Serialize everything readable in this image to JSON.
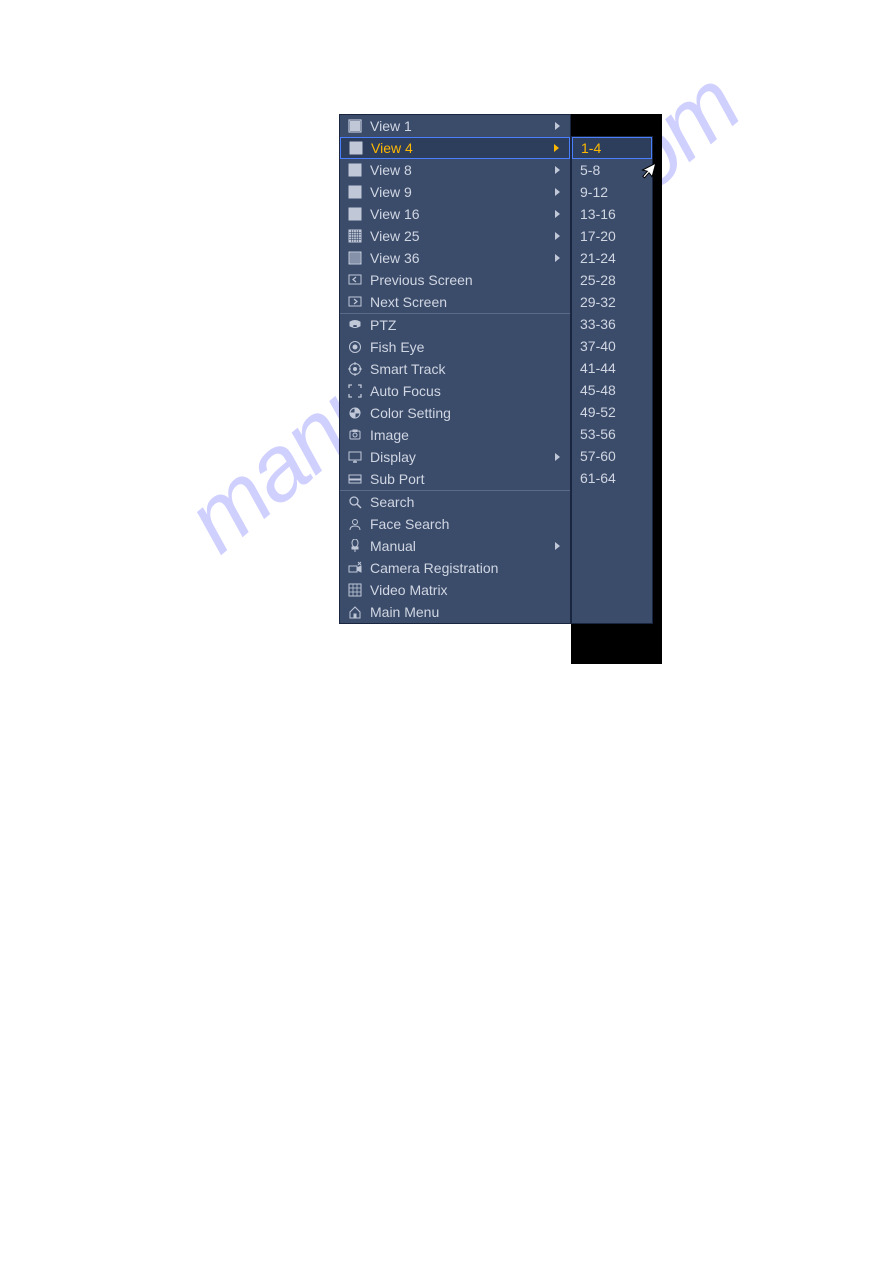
{
  "watermark": "manualshive.com",
  "menu": {
    "sections": [
      {
        "items": [
          {
            "label": "View 1",
            "icon": "view1",
            "arrow": true,
            "highlighted": false
          },
          {
            "label": "View 4",
            "icon": "view4",
            "arrow": true,
            "highlighted": true
          },
          {
            "label": "View 8",
            "icon": "view8",
            "arrow": true,
            "highlighted": false
          },
          {
            "label": "View 9",
            "icon": "view9",
            "arrow": true,
            "highlighted": false
          },
          {
            "label": "View 16",
            "icon": "view16",
            "arrow": true,
            "highlighted": false
          },
          {
            "label": "View 25",
            "icon": "view25",
            "arrow": true,
            "highlighted": false
          },
          {
            "label": "View 36",
            "icon": "view36",
            "arrow": true,
            "highlighted": false
          },
          {
            "label": "Previous Screen",
            "icon": "prev-screen",
            "arrow": false,
            "highlighted": false
          },
          {
            "label": "Next Screen",
            "icon": "next-screen",
            "arrow": false,
            "highlighted": false
          }
        ]
      },
      {
        "items": [
          {
            "label": "PTZ",
            "icon": "ptz",
            "arrow": false,
            "highlighted": false
          },
          {
            "label": "Fish Eye",
            "icon": "fisheye",
            "arrow": false,
            "highlighted": false
          },
          {
            "label": "Smart Track",
            "icon": "smart-track",
            "arrow": false,
            "highlighted": false
          },
          {
            "label": "Auto Focus",
            "icon": "auto-focus",
            "arrow": false,
            "highlighted": false
          },
          {
            "label": "Color Setting",
            "icon": "color-setting",
            "arrow": false,
            "highlighted": false
          },
          {
            "label": "Image",
            "icon": "image",
            "arrow": false,
            "highlighted": false
          },
          {
            "label": "Display",
            "icon": "display",
            "arrow": true,
            "highlighted": false
          },
          {
            "label": "Sub Port",
            "icon": "sub-port",
            "arrow": false,
            "highlighted": false
          }
        ]
      },
      {
        "items": [
          {
            "label": "Search",
            "icon": "search",
            "arrow": false,
            "highlighted": false
          },
          {
            "label": "Face Search",
            "icon": "face-search",
            "arrow": false,
            "highlighted": false
          },
          {
            "label": "Manual",
            "icon": "manual",
            "arrow": true,
            "highlighted": false
          },
          {
            "label": "Camera Registration",
            "icon": "camera-reg",
            "arrow": false,
            "highlighted": false
          },
          {
            "label": "Video Matrix",
            "icon": "video-matrix",
            "arrow": false,
            "highlighted": false
          },
          {
            "label": "Main Menu",
            "icon": "main-menu",
            "arrow": false,
            "highlighted": false
          }
        ]
      }
    ]
  },
  "submenu": {
    "items": [
      {
        "label": "1-4",
        "highlighted": true
      },
      {
        "label": "5-8",
        "highlighted": false
      },
      {
        "label": "9-12",
        "highlighted": false
      },
      {
        "label": "13-16",
        "highlighted": false
      },
      {
        "label": "17-20",
        "highlighted": false
      },
      {
        "label": "21-24",
        "highlighted": false
      },
      {
        "label": "25-28",
        "highlighted": false
      },
      {
        "label": "29-32",
        "highlighted": false
      },
      {
        "label": "33-36",
        "highlighted": false
      },
      {
        "label": "37-40",
        "highlighted": false
      },
      {
        "label": "41-44",
        "highlighted": false
      },
      {
        "label": "45-48",
        "highlighted": false
      },
      {
        "label": "49-52",
        "highlighted": false
      },
      {
        "label": "53-56",
        "highlighted": false
      },
      {
        "label": "57-60",
        "highlighted": false
      },
      {
        "label": "61-64",
        "highlighted": false
      }
    ]
  }
}
